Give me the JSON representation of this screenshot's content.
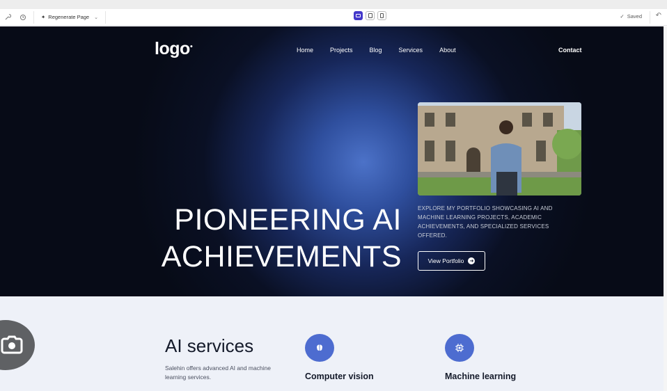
{
  "toolbar": {
    "regenerate_label": "Regenerate Page",
    "saved_label": "Saved",
    "device_modes": [
      "desktop",
      "tablet",
      "mobile"
    ],
    "active_device": "desktop",
    "accent": "#4338ca"
  },
  "site": {
    "logo": "logo",
    "nav": [
      "Home",
      "Projects",
      "Blog",
      "Services",
      "About"
    ],
    "contact": "Contact"
  },
  "hero": {
    "headline_line1": "PIONEERING AI",
    "headline_line2": "ACHIEVEMENTS",
    "tagline": "EXPLORE MY PORTFOLIO SHOWCASING AI AND MACHINE LEARNING PROJECTS, ACADEMIC ACHIEVEMENTS, AND SPECIALIZED SERVICES OFFERED.",
    "cta_label": "View Portfolio",
    "bg_color": "#070b17",
    "glow_color": "#4c72c8"
  },
  "services": {
    "title": "AI services",
    "description": "Salehin offers advanced AI and machine learning services.",
    "items": [
      {
        "label": "Computer vision",
        "icon": "brain-icon"
      },
      {
        "label": "Machine learning",
        "icon": "chip-icon"
      }
    ],
    "icon_color": "#4d6cd0"
  }
}
